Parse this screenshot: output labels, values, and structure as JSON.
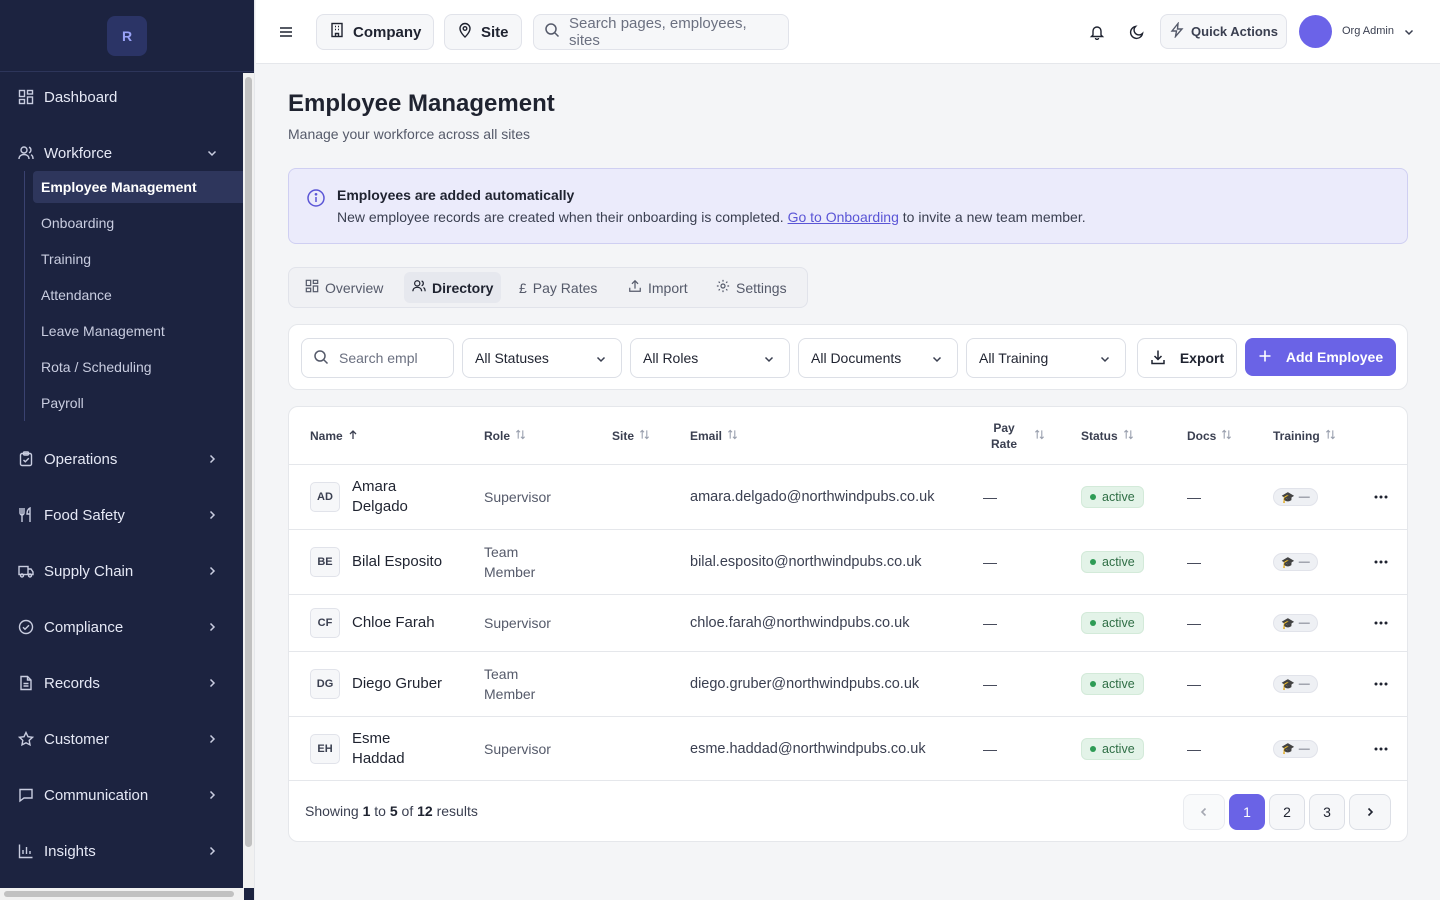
{
  "brand": {
    "logo_letter": "R"
  },
  "sidebar": {
    "dashboard": "Dashboard",
    "workforce": {
      "label": "Workforce",
      "items": [
        "Employee Management",
        "Onboarding",
        "Training",
        "Attendance",
        "Leave Management",
        "Rota / Scheduling",
        "Payroll"
      ],
      "active_item": "Employee Management"
    },
    "groups": [
      "Operations",
      "Food Safety",
      "Supply Chain",
      "Compliance",
      "Records",
      "Customer",
      "Communication",
      "Insights"
    ]
  },
  "topbar": {
    "company_label": "Company",
    "site_label": "Site",
    "search_placeholder": "Search pages, employees, sites",
    "quick_actions": "Quick Actions",
    "user_name": "Org Admin"
  },
  "page": {
    "title": "Employee Management",
    "subtitle": "Manage your workforce across all sites"
  },
  "banner": {
    "title": "Employees are added automatically",
    "text_before": "New employee records are created when their onboarding is completed. ",
    "link": "Go to Onboarding",
    "text_after": " to invite a new team member."
  },
  "tabs": {
    "items": [
      "Overview",
      "Directory",
      "Pay Rates",
      "Import",
      "Settings"
    ],
    "active": "Directory"
  },
  "filters": {
    "search_placeholder": "Search empl",
    "status": "All Statuses",
    "roles": "All Roles",
    "documents": "All Documents",
    "training": "All Training",
    "export": "Export",
    "add_employee": "Add Employee"
  },
  "table": {
    "headers": {
      "name": "Name",
      "role": "Role",
      "site": "Site",
      "email": "Email",
      "pay_rate_1": "Pay",
      "pay_rate_2": "Rate",
      "status": "Status",
      "docs": "Docs",
      "training": "Training"
    },
    "sort": {
      "column": "Name",
      "direction": "ascending"
    },
    "rows": [
      {
        "initials": "AD",
        "name_1": "Amara",
        "name_2": "Delgado",
        "role_1": "Supervisor",
        "role_2": "",
        "site": "",
        "email": "amara.delgado@northwindpubs.co.uk",
        "pay_rate": "—",
        "status": "active",
        "docs": "—",
        "training": "—"
      },
      {
        "initials": "BE",
        "name_1": "Bilal Esposito",
        "name_2": "",
        "role_1": "Team",
        "role_2": "Member",
        "site": "",
        "email": "bilal.esposito@northwindpubs.co.uk",
        "pay_rate": "—",
        "status": "active",
        "docs": "—",
        "training": "—"
      },
      {
        "initials": "CF",
        "name_1": "Chloe Farah",
        "name_2": "",
        "role_1": "Supervisor",
        "role_2": "",
        "site": "",
        "email": "chloe.farah@northwindpubs.co.uk",
        "pay_rate": "—",
        "status": "active",
        "docs": "—",
        "training": "—"
      },
      {
        "initials": "DG",
        "name_1": "Diego Gruber",
        "name_2": "",
        "role_1": "Team",
        "role_2": "Member",
        "site": "",
        "email": "diego.gruber@northwindpubs.co.uk",
        "pay_rate": "—",
        "status": "active",
        "docs": "—",
        "training": "—"
      },
      {
        "initials": "EH",
        "name_1": "Esme",
        "name_2": "Haddad",
        "role_1": "Supervisor",
        "role_2": "",
        "site": "",
        "email": "esme.haddad@northwindpubs.co.uk",
        "pay_rate": "—",
        "status": "active",
        "docs": "—",
        "training": "—"
      }
    ]
  },
  "pagination": {
    "showing_prefix": "Showing",
    "from": "1",
    "to_word": "to",
    "to": "5",
    "of_word": "of",
    "total": "12",
    "results_word": "results",
    "pages": [
      "1",
      "2",
      "3"
    ],
    "current": "1"
  },
  "colors": {
    "sidebar_bg": "#1c2340",
    "accent": "#6a63e6",
    "active_status": "#2e9b55",
    "banner_bg": "#ebebfb"
  }
}
